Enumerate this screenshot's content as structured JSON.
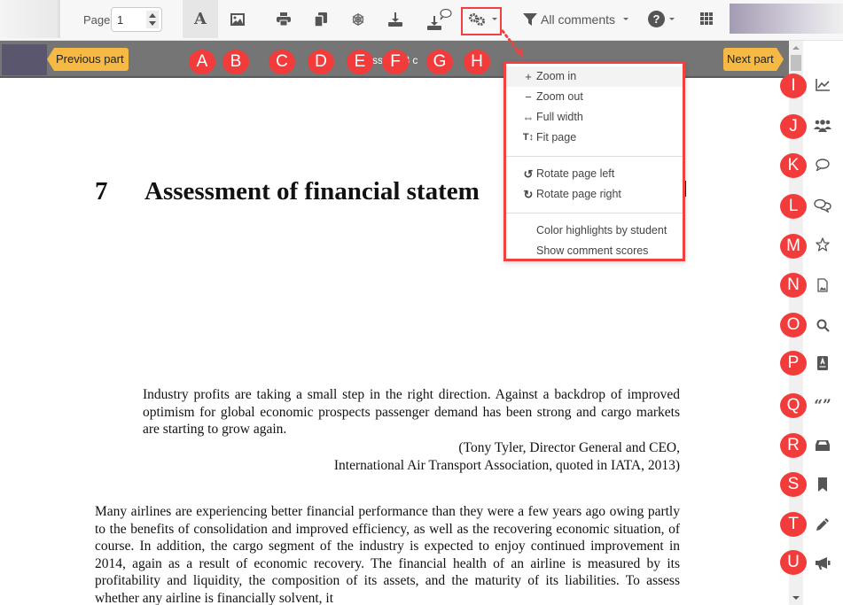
{
  "toolbar": {
    "page_label": "Page",
    "page_value": "1",
    "buttons": [
      {
        "name": "text-mode",
        "icon": "text-icon",
        "marker": "A"
      },
      {
        "name": "image-mode",
        "icon": "image-icon",
        "marker": "B"
      },
      {
        "name": "print",
        "icon": "print-icon",
        "marker": "C"
      },
      {
        "name": "copy",
        "icon": "copy-icon",
        "marker": "D"
      },
      {
        "name": "snowflake",
        "icon": "snowflake-icon",
        "marker": "E"
      },
      {
        "name": "download",
        "icon": "download-icon",
        "marker": "F"
      },
      {
        "name": "download-with-comments",
        "icon": "download-comments-icon",
        "marker": "G"
      },
      {
        "name": "settings",
        "icon": "cogs-icon",
        "marker": "H"
      }
    ],
    "filter_label": "All comments",
    "help_glyph": "?"
  },
  "partbar": {
    "prev_label": "Previous part",
    "next_label": "Next part",
    "title_fragment": "ss   ent   3 c"
  },
  "markers": {
    "top": [
      "A",
      "B",
      "C",
      "D",
      "E",
      "F",
      "G",
      "H"
    ],
    "side": [
      "I",
      "J",
      "K",
      "L",
      "M",
      "N",
      "O",
      "P",
      "Q",
      "R",
      "S",
      "T",
      "U"
    ]
  },
  "sidebar": {
    "items": [
      {
        "icon": "chart-line-icon",
        "marker": "I"
      },
      {
        "icon": "users-icon",
        "marker": "J"
      },
      {
        "icon": "comment-icon",
        "marker": "K"
      },
      {
        "icon": "comments-icon",
        "marker": "L"
      },
      {
        "icon": "star-icon",
        "marker": "M"
      },
      {
        "icon": "file-image-icon",
        "marker": "N"
      },
      {
        "icon": "search-icon",
        "marker": "O"
      },
      {
        "icon": "address-book-icon",
        "marker": "P"
      },
      {
        "icon": "quote-icon",
        "marker": "Q"
      },
      {
        "icon": "inbox-icon",
        "marker": "R"
      },
      {
        "icon": "bookmark-icon",
        "marker": "S"
      },
      {
        "icon": "pencil-icon",
        "marker": "T"
      },
      {
        "icon": "bullhorn-icon",
        "marker": "U"
      }
    ]
  },
  "dropdown": {
    "items": [
      {
        "icon": "+",
        "label": "Zoom in",
        "highlighted": true
      },
      {
        "icon": "−",
        "label": "Zoom out"
      },
      {
        "icon": "⇔",
        "label": "Full width"
      },
      {
        "icon": "T↕",
        "label": "Fit page"
      },
      {
        "icon": "↺",
        "label": "Rotate page left"
      },
      {
        "icon": "↻",
        "label": "Rotate page right"
      },
      {
        "icon": "",
        "label": "Color highlights by student"
      },
      {
        "icon": "",
        "label": "Show comment scores"
      }
    ]
  },
  "document": {
    "chapter_number": "7",
    "chapter_title": "Assessment of financial statem",
    "quote": "Industry profits are taking a small step in the right direction. Against a backdrop of improved optimism for global economic prospects passenger demand has been strong and cargo markets are starting to grow again.",
    "quote_attribution_1": "(Tony Tyler, Director General and CEO,",
    "quote_attribution_2": "International Air Transport Association, quoted in IATA, 2013)",
    "paragraph": "Many airlines are experiencing better financial performance than they were a few years ago owing partly to the benefits of consolidation and improved efficiency, as well as the recovering economic situation, of course. In addition, the cargo segment of the industry is expected to enjoy continued improvement in 2014, again as a result of economic recovery. The financial health of an airline is measured by its profitability and liquidity, the composition of its assets, and the maturity of its liabilities. To assess whether any airline is financially solvent, it"
  },
  "colors": {
    "marker": "#f23c3c",
    "part_button": "#f5b944",
    "partbar": "#757575",
    "highlight_border": "#f04040"
  }
}
